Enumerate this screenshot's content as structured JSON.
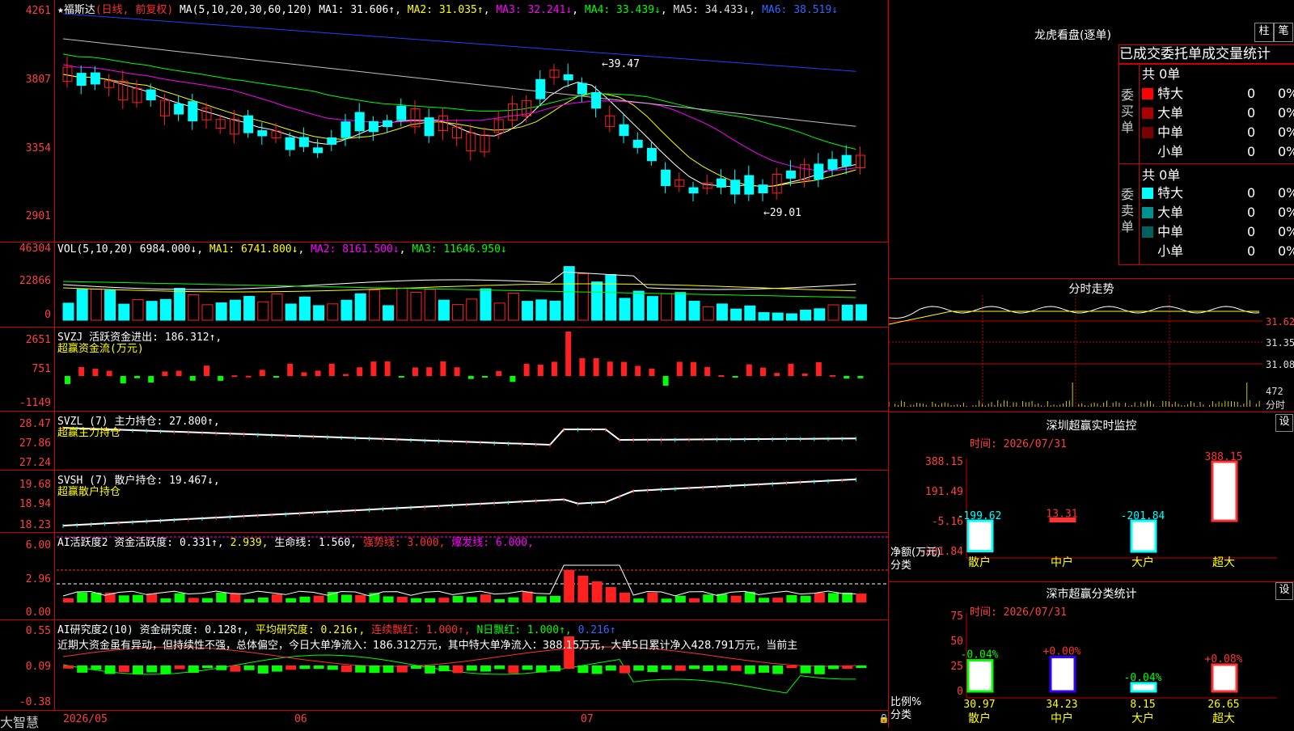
{
  "colors": {
    "up": "#ff2020",
    "down": "#00ffff",
    "ma1": "#ffffff",
    "ma2": "#ffff00",
    "ma3": "#ff00ff",
    "ma4": "#00ff00",
    "ma5": "#c0c0c0",
    "ma6": "#2040ff",
    "grid": "#cc0000"
  },
  "stock": {
    "name": "福斯达",
    "mode": "(日线, 前复权)",
    "ma_params": "MA(5,10,20,30,60,120)",
    "ma1": "MA1: 31.606↑",
    "ma2": "MA2: 31.035↑",
    "ma3": "MA3: 32.241↓",
    "ma4": "MA4: 33.439↓",
    "ma5": "MA5: 34.433↓",
    "ma6": "MA6: 38.519↓",
    "high_label": "←39.47",
    "low_label": "←29.01"
  },
  "main_axis": [
    "4261",
    "3807",
    "3354",
    "2901"
  ],
  "vol": {
    "header": "VOL(5,10,20)",
    "value": "6984.000↓",
    "ma1": "MA1: 6741.800↓",
    "ma2": "MA2: 8161.500↓",
    "ma3": "MA3: 11646.950↓",
    "axis": [
      "46304",
      "22866",
      "0"
    ]
  },
  "svzj": {
    "header": "SVZJ  活跃资金进出: 186.312↑,",
    "sub": "超赢资金流(万元)",
    "axis": [
      "2651",
      "751",
      "-1149"
    ]
  },
  "svzl": {
    "header": "SVZL (7) 主力持仓: 27.800↑,",
    "sub": "超赢主力持仓",
    "axis": [
      "28.47",
      "27.86",
      "27.24"
    ]
  },
  "svsh": {
    "header": "SVSH (7) 散户持仓: 19.467↓,",
    "sub": "超赢散户持仓",
    "axis": [
      "19.68",
      "18.94",
      "18.23"
    ]
  },
  "ai1": {
    "p1": "AI活跃度2 资金活跃度: 0.331↑,",
    "p2": "2.939,",
    "p3": "生命线: 1.560,",
    "p4": "强势线: 3.000,",
    "p5": "爆发线: 6.000,",
    "axis": [
      "6.00",
      "2.96",
      "0.00"
    ]
  },
  "ai2": {
    "p1": "AI研究度2(10) 资金研究度: 0.128↑,",
    "p2": "平均研究度: 0.216↑,",
    "p3": "连续飘红: 1.000↑,",
    "p4": "N日飘红: 1.000↑,",
    "p5": "0.216↑",
    "comment": "近期大资金虽有异动，但持续性不强，总体偏空，今日大单净流入：186.312万元，其中特大单净流入：388.15万元，大单5日累计净入428.791万元，当前主",
    "axis": [
      "0.55",
      "0.09",
      "-0.38"
    ]
  },
  "footer": {
    "brand": "大智慧",
    "d1": "2026/05",
    "d2": "06",
    "d3": "07"
  },
  "lhb": {
    "title": "龙虎看盘(逐单)",
    "btn1": "柱",
    "btn2": "笔",
    "sub": "已成交委托单成交量统计",
    "buy_label": "委买单",
    "sell_label": "委卖单",
    "buy_total": "共 0单",
    "sell_total": "共 0单",
    "buy_rows": [
      {
        "name": "特大",
        "vol": "0",
        "pct": "0%",
        "color": "#ff0000"
      },
      {
        "name": "大单",
        "vol": "0",
        "pct": "0%",
        "color": "#aa0000"
      },
      {
        "name": "中单",
        "vol": "0",
        "pct": "0%",
        "color": "#770000"
      },
      {
        "name": "小单",
        "vol": "0",
        "pct": "0%",
        "color": "#000000"
      }
    ],
    "sell_rows": [
      {
        "name": "特大",
        "vol": "0",
        "pct": "0%",
        "color": "#00ffff"
      },
      {
        "name": "大单",
        "vol": "0",
        "pct": "0%",
        "color": "#009090"
      },
      {
        "name": "中单",
        "vol": "0",
        "pct": "0%",
        "color": "#006060"
      },
      {
        "name": "小单",
        "vol": "0",
        "pct": "0%",
        "color": "#000000"
      }
    ]
  },
  "fs": {
    "title": "分时走势",
    "axis": [
      "31.62",
      "31.35",
      "31.08"
    ],
    "vol_label": "472",
    "vol_unit": "分时"
  },
  "szjk": {
    "title": "深圳超赢实时监控",
    "btn": "设",
    "time": "时间: 2026/07/31",
    "axis": [
      "388.15",
      "191.49",
      "-5.16",
      "-201.84"
    ],
    "unit": "净额(万元)",
    "cat": "分类",
    "chart_data": {
      "type": "bar",
      "categories": [
        "散户",
        "中户",
        "大户",
        "超大"
      ],
      "values": [
        -199.62,
        13.31,
        -201.84,
        388.15
      ],
      "ylim": [
        -201.84,
        388.15
      ]
    }
  },
  "sfl": {
    "title": "深市超赢分类统计",
    "btn": "设",
    "time": "时间: 2026/07/31",
    "axis": [
      "75",
      "50",
      "25",
      "0"
    ],
    "unit": "比例%",
    "cat": "分类",
    "chart_data": {
      "type": "bar",
      "categories": [
        "散户",
        "中户",
        "大户",
        "超大"
      ],
      "values": [
        30.97,
        34.23,
        8.15,
        26.65
      ],
      "changes": [
        "-0.04%",
        "+0.00%",
        "-0.04%",
        "+0.08%"
      ],
      "ylim": [
        0,
        75
      ]
    }
  }
}
